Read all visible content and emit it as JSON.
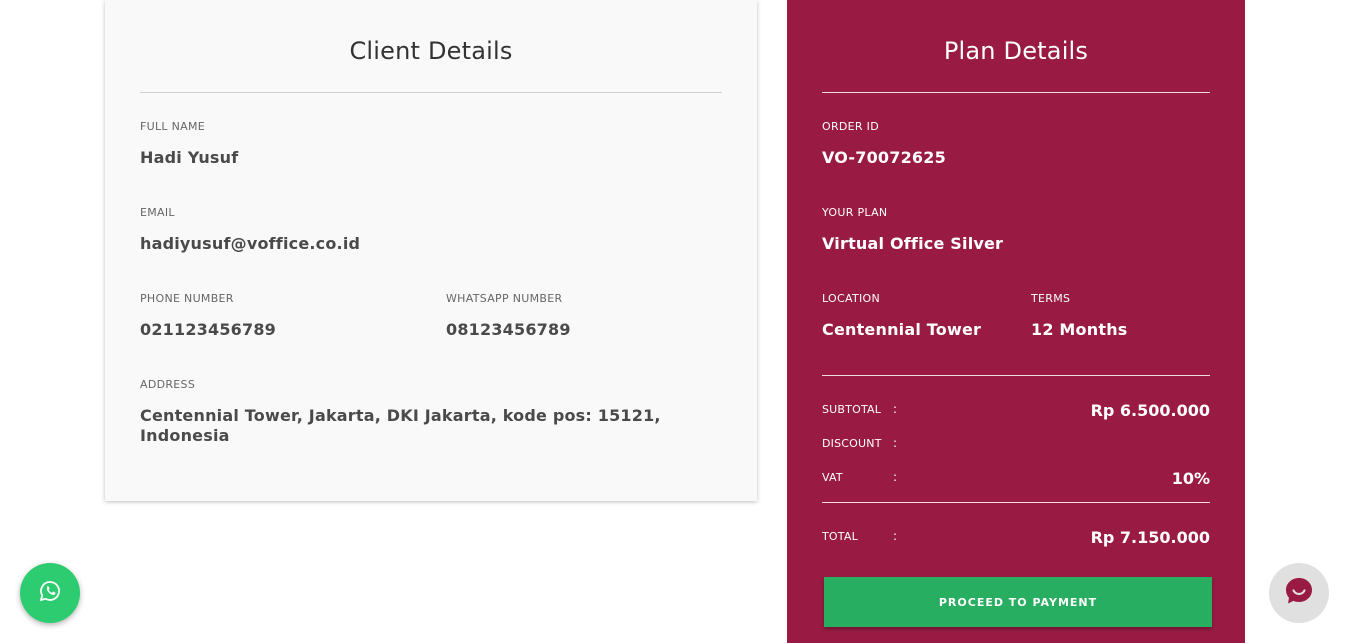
{
  "client": {
    "title": "Client Details",
    "full_name_label": "FULL NAME",
    "full_name": "Hadi Yusuf",
    "email_label": "EMAIL",
    "email": "hadiyusuf@voffice.co.id",
    "phone_label": "PHONE NUMBER",
    "phone": "021123456789",
    "whatsapp_label": "WHATSAPP NUMBER",
    "whatsapp": "08123456789",
    "address_label": "ADDRESS",
    "address_line1": "Centennial Tower, Jakarta, DKI Jakarta, kode pos: 15121,",
    "address_line2": "Indonesia"
  },
  "plan": {
    "title": "Plan Details",
    "order_id_label": "ORDER ID",
    "order_id": "VO-70072625",
    "plan_label": "YOUR PLAN",
    "plan": "Virtual Office Silver",
    "location_label": "LOCATION",
    "location": "Centennial Tower",
    "terms_label": "TERMS",
    "terms": "12 Months",
    "summary": {
      "subtotal_label": "SUBTOTAL",
      "subtotal": "Rp 6.500.000",
      "discount_label": "DISCOUNT",
      "discount": "",
      "vat_label": "VAT",
      "vat": "10%",
      "total_label": "TOTAL",
      "total": "Rp 7.150.000",
      "colon": ":"
    },
    "pay_button": "PROCEED TO PAYMENT"
  },
  "colors": {
    "plan_bg": "#991b43",
    "pay_button": "#27ae60",
    "whatsapp": "#2ecc71",
    "chat_icon": "#991b43"
  },
  "icons": {
    "whatsapp_fab": "whatsapp-icon",
    "chat_fab": "chat-icon"
  }
}
